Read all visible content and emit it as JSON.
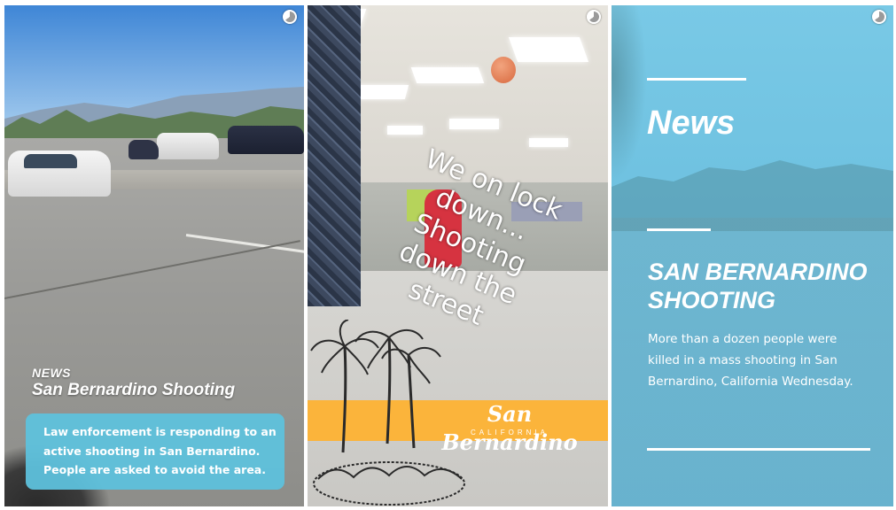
{
  "panel1": {
    "news_label": "NEWS",
    "headline": "San Bernardino Shooting",
    "body": "Law enforcement is responding to an active shooting in San Bernardino. People are asked to avoid the area.",
    "accent_color": "#5ec1dd"
  },
  "panel2": {
    "caption": "We on lock down... Shooting down the street",
    "band_title": "San Bernardino",
    "band_subtitle": "CALIFORNIA",
    "band_color": "#fbb43b"
  },
  "panel3": {
    "news_label": "News",
    "headline": "SAN BERNARDINO SHOOTING",
    "body": "More than a dozen people were killed in a mass shooting in San Bernardino, California Wednesday.",
    "overlay_color": "#6ec1e0"
  },
  "icons": {
    "timer": "story-timer-icon"
  }
}
